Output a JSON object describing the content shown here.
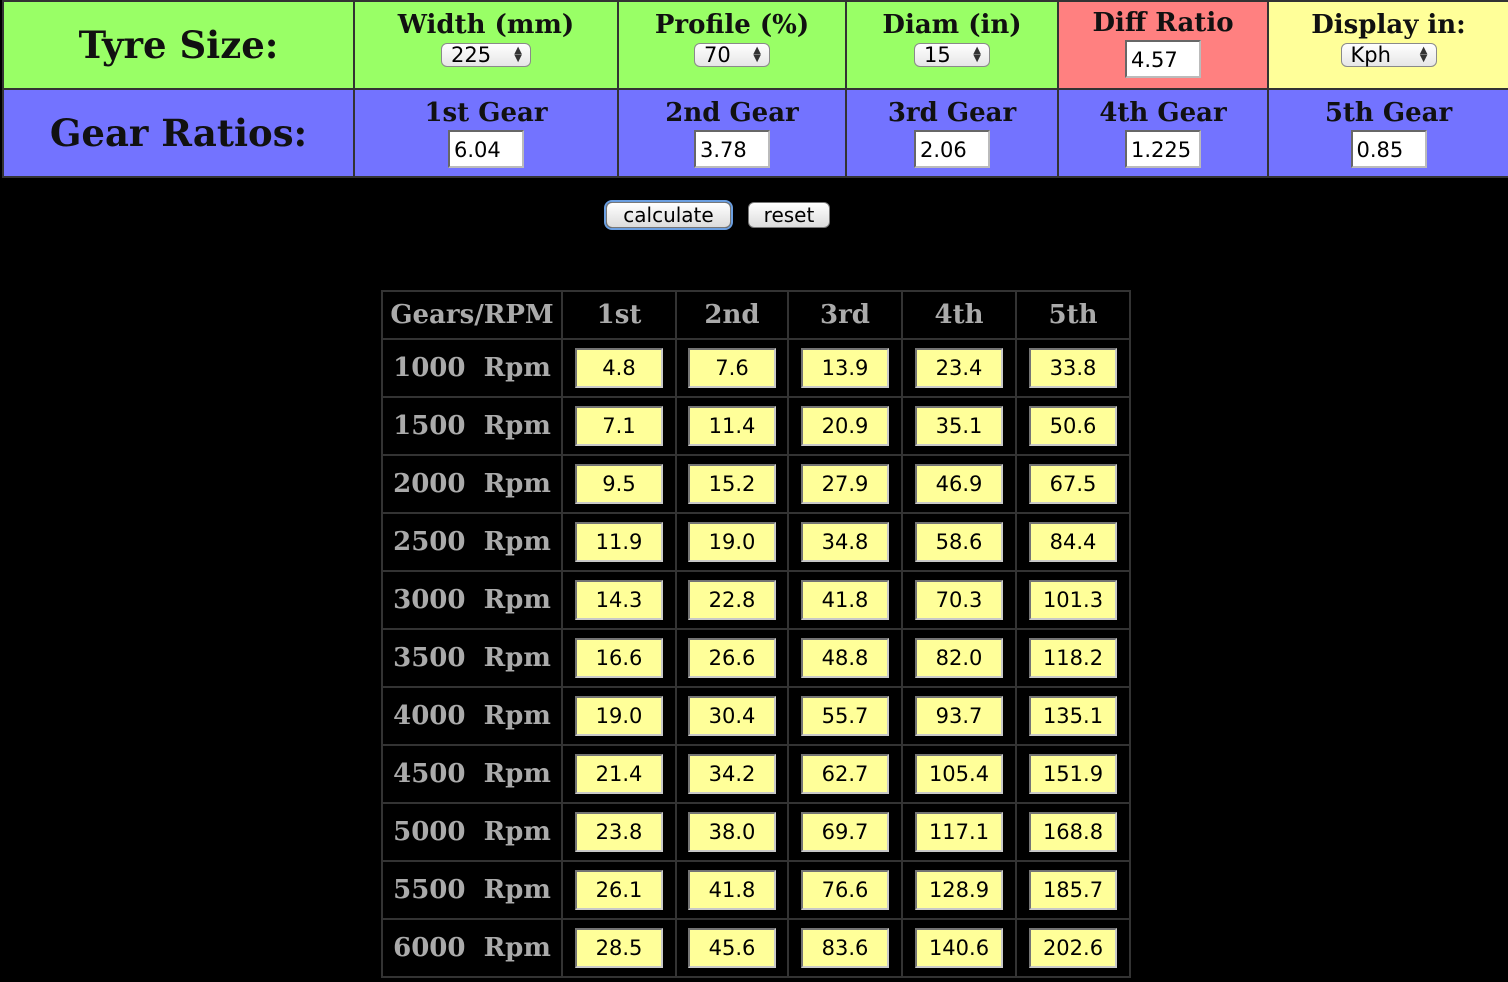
{
  "tyre": {
    "row_label": "Tyre Size:",
    "width": {
      "label": "Width (mm)",
      "value": "225"
    },
    "profile": {
      "label": "Profile (%)",
      "value": "70"
    },
    "diam": {
      "label": "Diam (in)",
      "value": "15"
    },
    "diff": {
      "label": "Diff Ratio",
      "value": "4.57"
    },
    "display": {
      "label": "Display in:",
      "value": "Kph"
    }
  },
  "gears": {
    "row_label": "Gear Ratios:",
    "items": [
      {
        "label": "1st Gear",
        "value": "6.04"
      },
      {
        "label": "2nd Gear",
        "value": "3.78"
      },
      {
        "label": "3rd Gear",
        "value": "2.06"
      },
      {
        "label": "4th Gear",
        "value": "1.225"
      },
      {
        "label": "5th Gear",
        "value": "0.85"
      }
    ]
  },
  "buttons": {
    "calculate": "calculate",
    "reset": "reset"
  },
  "results": {
    "headers": [
      "Gears/RPM",
      "1st",
      "2nd",
      "3rd",
      "4th",
      "5th"
    ],
    "rows": [
      {
        "rpm": "1000  Rpm",
        "values": [
          "4.8",
          "7.6",
          "13.9",
          "23.4",
          "33.8"
        ]
      },
      {
        "rpm": "1500  Rpm",
        "values": [
          "7.1",
          "11.4",
          "20.9",
          "35.1",
          "50.6"
        ]
      },
      {
        "rpm": "2000  Rpm",
        "values": [
          "9.5",
          "15.2",
          "27.9",
          "46.9",
          "67.5"
        ]
      },
      {
        "rpm": "2500  Rpm",
        "values": [
          "11.9",
          "19.0",
          "34.8",
          "58.6",
          "84.4"
        ]
      },
      {
        "rpm": "3000  Rpm",
        "values": [
          "14.3",
          "22.8",
          "41.8",
          "70.3",
          "101.3"
        ]
      },
      {
        "rpm": "3500  Rpm",
        "values": [
          "16.6",
          "26.6",
          "48.8",
          "82.0",
          "118.2"
        ]
      },
      {
        "rpm": "4000  Rpm",
        "values": [
          "19.0",
          "30.4",
          "55.7",
          "93.7",
          "135.1"
        ]
      },
      {
        "rpm": "4500  Rpm",
        "values": [
          "21.4",
          "34.2",
          "62.7",
          "105.4",
          "151.9"
        ]
      },
      {
        "rpm": "5000  Rpm",
        "values": [
          "23.8",
          "38.0",
          "69.7",
          "117.1",
          "168.8"
        ]
      },
      {
        "rpm": "5500  Rpm",
        "values": [
          "26.1",
          "41.8",
          "76.6",
          "128.9",
          "185.7"
        ]
      },
      {
        "rpm": "6000  Rpm",
        "values": [
          "28.5",
          "45.6",
          "83.6",
          "140.6",
          "202.6"
        ]
      }
    ]
  }
}
